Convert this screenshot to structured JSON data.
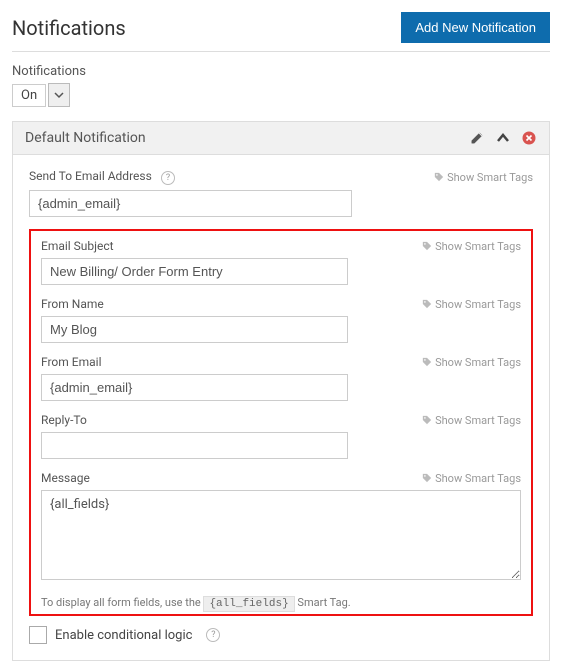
{
  "header": {
    "title": "Notifications",
    "add_button": "Add New Notification"
  },
  "toggle": {
    "label": "Notifications",
    "value": "On"
  },
  "panel": {
    "title": "Default Notification"
  },
  "smart_tags_label": "Show Smart Tags",
  "fields": {
    "send_to": {
      "label": "Send To Email Address",
      "value": "{admin_email}"
    },
    "subject": {
      "label": "Email Subject",
      "value": "New Billing/ Order Form Entry"
    },
    "from_name": {
      "label": "From Name",
      "value": "My Blog"
    },
    "from_email": {
      "label": "From Email",
      "value": "{admin_email}"
    },
    "reply_to": {
      "label": "Reply-To",
      "value": ""
    },
    "message": {
      "label": "Message",
      "value": "{all_fields}"
    }
  },
  "hint": {
    "pre": "To display all form fields, use the",
    "code": "{all_fields}",
    "post": "Smart Tag."
  },
  "conditional": {
    "label": "Enable conditional logic"
  }
}
